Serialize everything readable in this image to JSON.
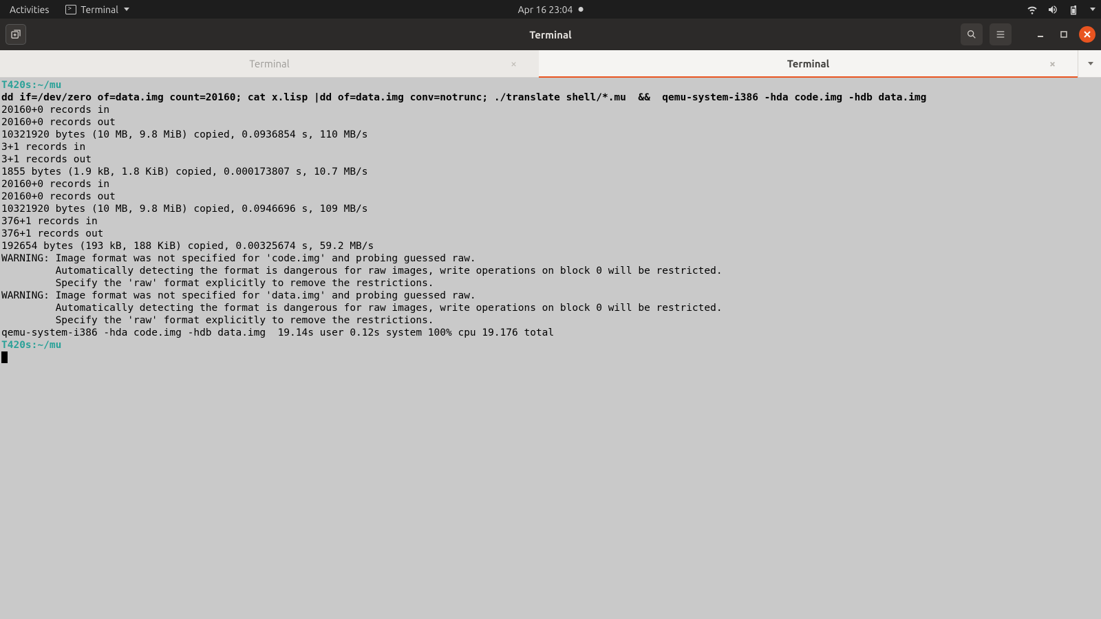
{
  "topbar": {
    "activities": "Activities",
    "app_name": "Terminal",
    "datetime": "Apr 16  23:04"
  },
  "window": {
    "title": "Terminal"
  },
  "tabs": [
    {
      "label": "Terminal",
      "active": false
    },
    {
      "label": "Terminal",
      "active": true
    }
  ],
  "term": {
    "prompt1": "T420s:~/mu",
    "command": "dd if=/dev/zero of=data.img count=20160; cat x.lisp |dd of=data.img conv=notrunc; ./translate shell/*.mu  &&  qemu-system-i386 -hda code.img -hdb data.img",
    "lines": [
      "20160+0 records in",
      "20160+0 records out",
      "10321920 bytes (10 MB, 9.8 MiB) copied, 0.0936854 s, 110 MB/s",
      "3+1 records in",
      "3+1 records out",
      "1855 bytes (1.9 kB, 1.8 KiB) copied, 0.000173807 s, 10.7 MB/s",
      "20160+0 records in",
      "20160+0 records out",
      "10321920 bytes (10 MB, 9.8 MiB) copied, 0.0946696 s, 109 MB/s",
      "376+1 records in",
      "376+1 records out",
      "192654 bytes (193 kB, 188 KiB) copied, 0.00325674 s, 59.2 MB/s",
      "WARNING: Image format was not specified for 'code.img' and probing guessed raw.",
      "         Automatically detecting the format is dangerous for raw images, write operations on block 0 will be restricted.",
      "         Specify the 'raw' format explicitly to remove the restrictions.",
      "WARNING: Image format was not specified for 'data.img' and probing guessed raw.",
      "         Automatically detecting the format is dangerous for raw images, write operations on block 0 will be restricted.",
      "         Specify the 'raw' format explicitly to remove the restrictions.",
      "qemu-system-i386 -hda code.img -hdb data.img  19.14s user 0.12s system 100% cpu 19.176 total"
    ],
    "prompt2": "T420s:~/mu"
  }
}
